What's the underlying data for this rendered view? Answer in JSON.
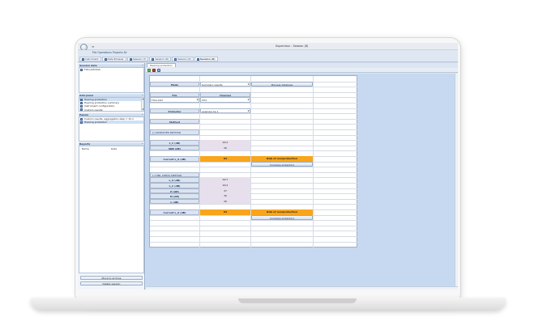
{
  "window": {
    "qat_label": "≡",
    "title": "Supervisor - Session (8)",
    "ribbon_title": "File  Operations  Projects  All"
  },
  "tabs": [
    {
      "label": "Instrument"
    },
    {
      "label": "Data Browser"
    },
    {
      "label": "Session (7)"
    },
    {
      "label": "Session (6)"
    },
    {
      "label": "Session (5)"
    },
    {
      "label": "Session (8)"
    }
  ],
  "left_panel": {
    "session_data": {
      "title": "Session data",
      "pin": "^",
      "items": [
        {
          "label": "FULL-DAY.SVL"
        }
      ]
    },
    "add_panel": {
      "title": "Add panel",
      "pin": "^",
      "items": [
        {
          "label": "Hearing protection"
        },
        {
          "label": "Hearing protection summary"
        },
        {
          "label": "Instrument configuration"
        },
        {
          "label": "Custom results"
        }
      ]
    },
    "panels": {
      "title": "Panels",
      "pin": "^",
      "items": [
        {
          "label": "Custom results, aggregation step = 1h:o"
        },
        {
          "label": "Hearing protection"
        }
      ]
    },
    "reports": {
      "title": "Reports",
      "pin": "^",
      "col_name": "Name",
      "col_date": "Date"
    },
    "buttons": {
      "move": "Move to archive",
      "delete": "Delete session"
    }
  },
  "document": {
    "tab_title": "Hearing protection",
    "mode_label": "Mode",
    "mode_value": "Summary results",
    "manage_button": "Manage database",
    "file_label": "File",
    "channel_label": "Channel",
    "file_value": "FULL-DAY",
    "channel_value": "CH1",
    "protector_label": "Protector",
    "protector_value": "example hp 1",
    "method_label": "Method",
    "snr_method": "[-] SIMPLIFIED METHOD",
    "snr_rows": [
      {
        "label": "L_C (dB)",
        "value": "90.2"
      },
      {
        "label": "SNR (dB)",
        "value": "26"
      }
    ],
    "current_label": "Current L_A (dB)",
    "current_value_1": "84",
    "risk_1": "Risk of overprotection",
    "compare_button_1": "Compare protectors",
    "hml_method": "[-] HML CHECK METHOD",
    "hml_rows": [
      {
        "label": "L_A (dB)",
        "value": "90.7"
      },
      {
        "label": "L_C (dB)",
        "value": "90.2"
      },
      {
        "label": "H (dB)",
        "value": "37"
      },
      {
        "label": "M (dB)",
        "value": "30"
      },
      {
        "label": "L (dB)",
        "value": "26"
      }
    ],
    "current_value_2": "84",
    "risk_2": "Risk of overprotection",
    "compare_button_2": "Compare protectors"
  },
  "colors": {
    "accent_orange": "#f9a51b",
    "header_blue": "#dce4f1",
    "workspace_blue": "#c6d9f0"
  }
}
